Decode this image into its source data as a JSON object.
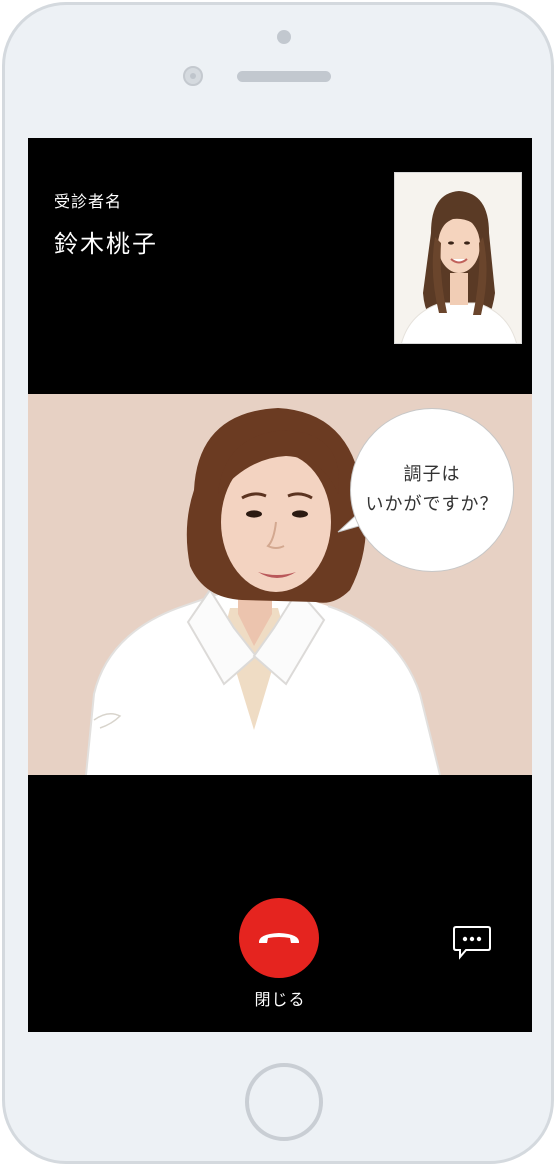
{
  "patient": {
    "label": "受診者名",
    "name": "鈴木桃子"
  },
  "doctor": {
    "speech_line1": "調子は",
    "speech_line2": "いかがですか？"
  },
  "controls": {
    "end_call_label": "閉じる",
    "end_call_icon": "phone-hangup-icon",
    "chat_icon": "chat-bubble-icon"
  },
  "colors": {
    "end_call": "#e5241f",
    "screen_bg": "#000000",
    "doctor_bg": "#e7d1c4"
  }
}
